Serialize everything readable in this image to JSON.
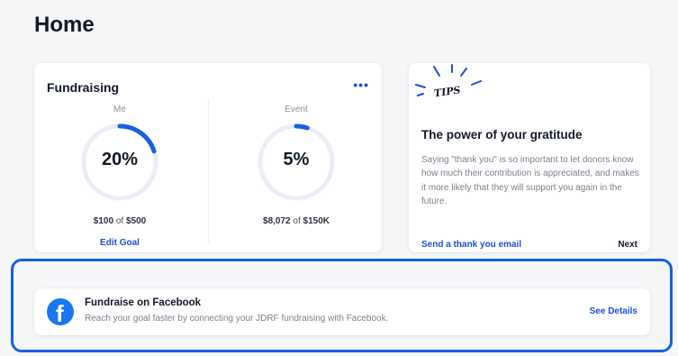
{
  "page": {
    "title": "Home"
  },
  "fundraising": {
    "title": "Fundraising",
    "more_label": "•••",
    "me": {
      "label": "Me",
      "percent_text": "20%",
      "progress": 0.2,
      "raised": "$100",
      "of": "of",
      "goal": "$500",
      "edit_label": "Edit Goal"
    },
    "event": {
      "label": "Event",
      "percent_text": "5%",
      "progress": 0.05,
      "raised": "$8,072",
      "of": "of",
      "goal": "$150K"
    },
    "colors": {
      "ring_track": "#e8edf6",
      "ring_fill": "#1a5fe0"
    }
  },
  "tips": {
    "art_text": "TIPS",
    "heading": "The power of your gratitude",
    "body": "Saying \"thank you\" is so important to let donors know how much their contribution is appreciated, and makes it more likely that they will support you again in the future.",
    "link_label": "Send a thank you email",
    "next_label": "Next"
  },
  "facebook": {
    "icon": "facebook-icon",
    "icon_glyph": "f",
    "title": "Fundraise on Facebook",
    "description": "Reach your goal faster by connecting your JDRF fundraising with Facebook.",
    "details_label": "See Details",
    "brand_color": "#1877f2"
  },
  "accent_color": "#1a4fd8"
}
